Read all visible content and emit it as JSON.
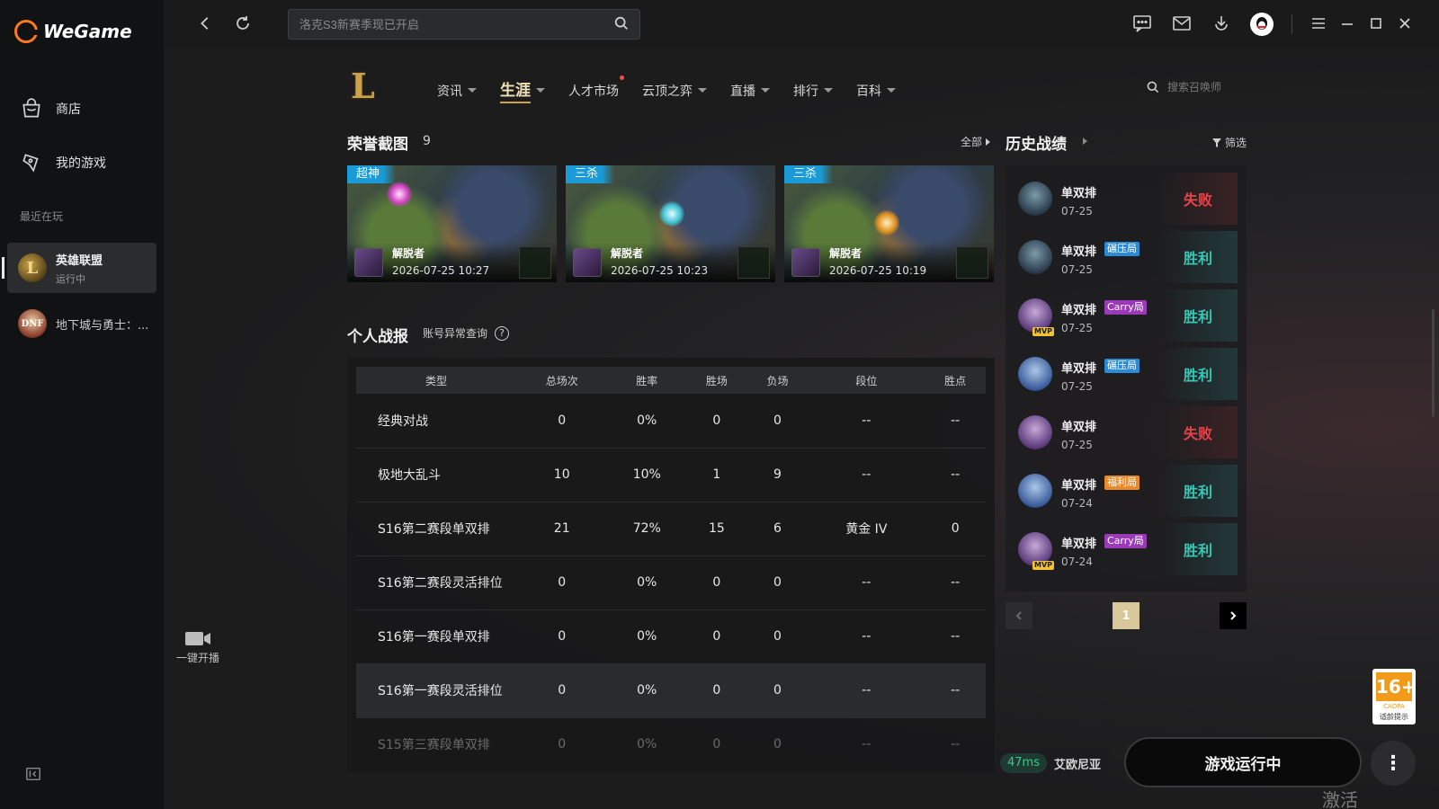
{
  "app": {
    "name": "WeGame"
  },
  "sidebar": {
    "items": [
      {
        "label": "商店",
        "icon": "shop-bag-icon"
      },
      {
        "label": "我的游戏",
        "icon": "gamepad-icon"
      }
    ],
    "recent_label": "最近在玩",
    "recent_games": [
      {
        "name": "英雄联盟",
        "status": "运行中",
        "icon": "lol-game-icon",
        "active": true
      },
      {
        "name": "地下城与勇士：...",
        "status": "",
        "icon": "dnf-game-icon",
        "active": false
      }
    ],
    "live_label": "一键开播"
  },
  "topbar": {
    "search_placeholder": "洛克S3新赛季现已开启",
    "icons": [
      "back-icon",
      "refresh-icon",
      "chat-icon",
      "mail-icon",
      "download-icon",
      "qq-avatar-icon",
      "menu-icon",
      "minimize-icon",
      "maximize-icon",
      "close-icon"
    ]
  },
  "game_nav": {
    "items": [
      {
        "label": "资讯",
        "caret": true,
        "dot": false,
        "active": false
      },
      {
        "label": "生涯",
        "caret": true,
        "dot": false,
        "active": true
      },
      {
        "label": "人才市场",
        "caret": false,
        "dot": true,
        "active": false
      },
      {
        "label": "云顶之弈",
        "caret": true,
        "dot": false,
        "active": false
      },
      {
        "label": "直播",
        "caret": true,
        "dot": false,
        "active": false
      },
      {
        "label": "排行",
        "caret": true,
        "dot": false,
        "active": false
      },
      {
        "label": "百科",
        "caret": true,
        "dot": false,
        "active": false
      }
    ],
    "summoner_search_placeholder": "搜索召唤师"
  },
  "honor": {
    "title": "荣誉截图",
    "count": "9",
    "all_label": "全部",
    "shots": [
      {
        "tag": "超神",
        "player": "解脱者",
        "time": "2026-07-25 10:27"
      },
      {
        "tag": "三杀",
        "player": "解脱者",
        "time": "2026-07-25 10:23"
      },
      {
        "tag": "三杀",
        "player": "解脱者",
        "time": "2026-07-25 10:19"
      }
    ]
  },
  "history": {
    "title": "历史战绩",
    "filter_label": "筛选",
    "matches": [
      {
        "mode": "单双排",
        "badge": "",
        "badge_color": "",
        "date": "07-25",
        "result": "失败",
        "win": false,
        "mvp": false,
        "avatar": "teal"
      },
      {
        "mode": "单双排",
        "badge": "碾压局",
        "badge_color": "#2a8ad6",
        "date": "07-25",
        "result": "胜利",
        "win": true,
        "mvp": false,
        "avatar": "teal"
      },
      {
        "mode": "单双排",
        "badge": "Carry局",
        "badge_color": "#9a3ab8",
        "date": "07-25",
        "result": "胜利",
        "win": true,
        "mvp": true,
        "avatar": "purple"
      },
      {
        "mode": "单双排",
        "badge": "碾压局",
        "badge_color": "#2a8ad6",
        "date": "07-25",
        "result": "胜利",
        "win": true,
        "mvp": false,
        "avatar": "blue"
      },
      {
        "mode": "单双排",
        "badge": "",
        "badge_color": "",
        "date": "07-25",
        "result": "失败",
        "win": false,
        "mvp": false,
        "avatar": "purple"
      },
      {
        "mode": "单双排",
        "badge": "福利局",
        "badge_color": "#e88a2a",
        "date": "07-24",
        "result": "胜利",
        "win": true,
        "mvp": false,
        "avatar": "blue"
      },
      {
        "mode": "单双排",
        "badge": "Carry局",
        "badge_color": "#9a3ab8",
        "date": "07-24",
        "result": "胜利",
        "win": true,
        "mvp": true,
        "avatar": "purple"
      }
    ],
    "page": "1"
  },
  "personal": {
    "title": "个人战报",
    "anomaly_label": "账号异常查询",
    "columns": [
      "类型",
      "总场次",
      "胜率",
      "胜场",
      "负场",
      "段位",
      "胜点"
    ],
    "rows": [
      [
        "经典对战",
        "0",
        "0%",
        "0",
        "0",
        "--",
        "--"
      ],
      [
        "极地大乱斗",
        "10",
        "10%",
        "1",
        "9",
        "--",
        "--"
      ],
      [
        "S16第二赛段单双排",
        "21",
        "72%",
        "15",
        "6",
        "黄金 IV",
        "0"
      ],
      [
        "S16第二赛段灵活排位",
        "0",
        "0%",
        "0",
        "0",
        "--",
        "--"
      ],
      [
        "S16第一赛段单双排",
        "0",
        "0%",
        "0",
        "0",
        "--",
        "--"
      ],
      [
        "S16第一赛段灵活排位",
        "0",
        "0%",
        "0",
        "0",
        "--",
        "--"
      ],
      [
        "S15第三赛段单双排",
        "0",
        "0%",
        "0",
        "0",
        "--",
        "--"
      ]
    ]
  },
  "bottom": {
    "ping": "47ms",
    "server": "艾欧尼亚",
    "play_label": "游戏运行中",
    "more_label": "⋮",
    "age_rating": "16+",
    "age_org": "CADPA",
    "age_tip": "适龄提示",
    "watermark": "激活 Windows"
  },
  "colors": {
    "accent_gold": "#c9a24a",
    "win": "#36c8b4",
    "lose": "#e8434a",
    "shot_tag": "#1a9ad6"
  }
}
